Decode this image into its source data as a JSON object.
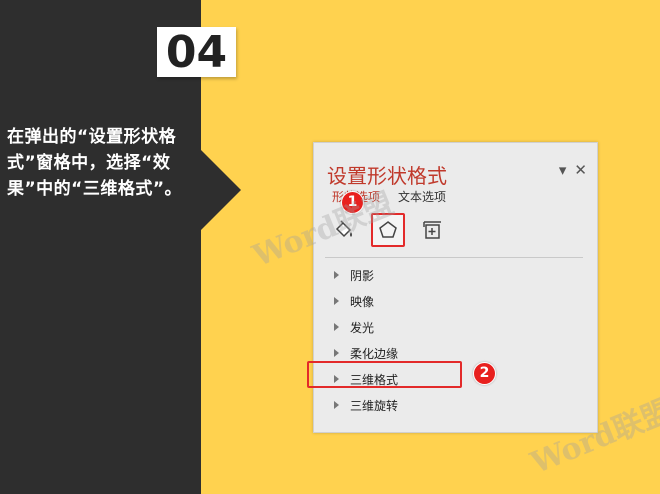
{
  "step": {
    "number": "04"
  },
  "instruction": {
    "text": "在弹出的“设置形状格式”窗格中，选择“效果”中的“三维格式”。"
  },
  "pane": {
    "title": "设置形状格式",
    "dropdown_glyph": "▾",
    "close_glyph": "✕",
    "tabs": [
      {
        "label": "形状选项"
      },
      {
        "label": "文本选项"
      }
    ],
    "icons": [
      "fill-line-icon",
      "effects-icon",
      "size-properties-icon"
    ],
    "menu_items": [
      {
        "label": "阴影"
      },
      {
        "label": "映像"
      },
      {
        "label": "发光"
      },
      {
        "label": "柔化边缘"
      },
      {
        "label": "三维格式"
      },
      {
        "label": "三维旋转"
      }
    ]
  },
  "callouts": [
    {
      "label": "1"
    },
    {
      "label": "2"
    }
  ],
  "watermark": {
    "text": "Word联盟"
  },
  "colors": {
    "dark_panel": "#2e2e2e",
    "yellow_bg": "#ffd24f",
    "accent_red": "#e32a2a",
    "title_red": "#c0392b"
  }
}
